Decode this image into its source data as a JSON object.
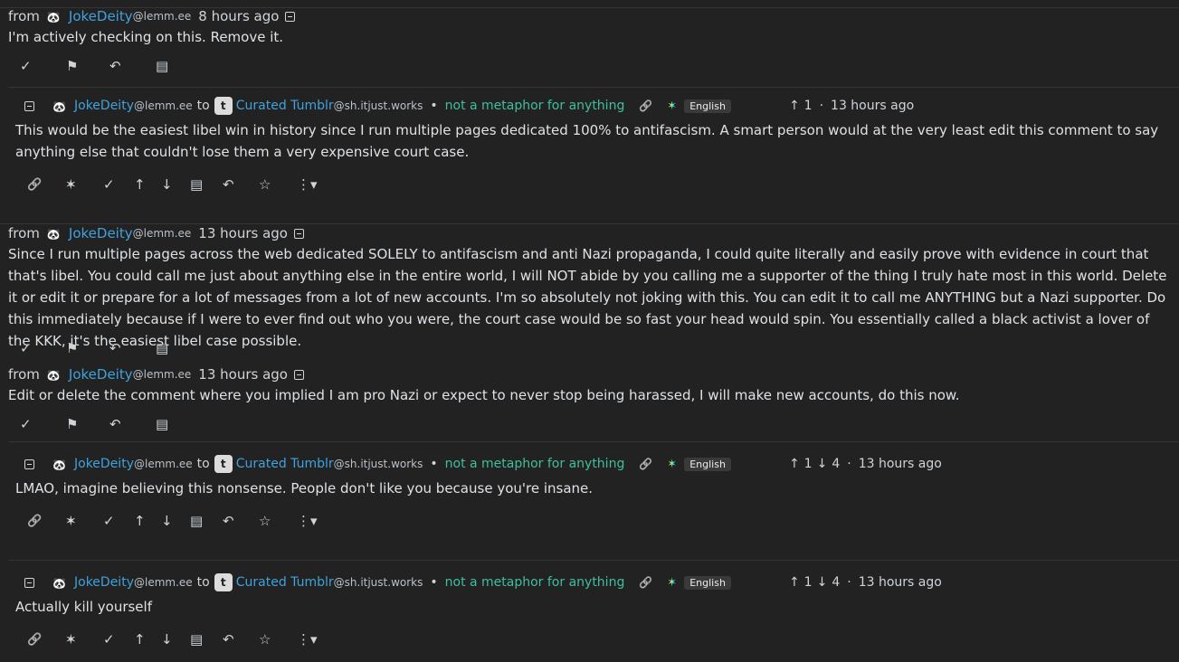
{
  "messages": [
    {
      "from": "from",
      "user": "JokeDeity",
      "instance": "@lemm.ee",
      "time": "8 hours ago",
      "text": "I'm actively checking on this. Remove it."
    },
    {
      "from": "from",
      "user": "JokeDeity",
      "instance": "@lemm.ee",
      "time": "13 hours ago",
      "text": "Since I run multiple pages across the web dedicated SOLELY to antifascism and anti Nazi propaganda, I could quite literally and easily prove with evidence in court that that's libel. You could call me just about anything else in the entire world, I will NOT abide by you calling me a supporter of the thing I truly hate most in this world. Delete it or edit it or prepare for a lot of messages from a lot of new accounts. I'm so absolutely not joking with this. You can edit it to call me ANYTHING but a Nazi supporter. Do this immediately because if I were to ever find out who you were, the court case would be so fast your head would spin. You essentially called a black activist a lover of the KKK, it's the easiest libel case possible."
    },
    {
      "from": "from",
      "user": "JokeDeity",
      "instance": "@lemm.ee",
      "time": "13 hours ago",
      "text": "Edit or delete the comment where you implied I am pro Nazi or expect to never stop being harassed, I will make new accounts, do this now."
    }
  ],
  "comments": [
    {
      "user": "JokeDeity",
      "instance": "@lemm.ee",
      "to": "to",
      "community": "Curated Tumblr",
      "community_instance": "@sh.itjust.works",
      "post_title": "not a metaphor for anything",
      "language": "English",
      "upvotes": "1",
      "downvotes": "",
      "time": "13 hours ago",
      "text": "This would be the easiest libel win in history since I run multiple pages dedicated 100% to antifascism. A smart person would at the very least edit this comment to say anything else that couldn't lose them a very expensive court case."
    },
    {
      "user": "JokeDeity",
      "instance": "@lemm.ee",
      "to": "to",
      "community": "Curated Tumblr",
      "community_instance": "@sh.itjust.works",
      "post_title": "not a metaphor for anything",
      "language": "English",
      "upvotes": "1",
      "downvotes": "4",
      "time": "13 hours ago",
      "text": "LMAO, imagine believing this nonsense. People don't like you because you're insane."
    },
    {
      "user": "JokeDeity",
      "instance": "@lemm.ee",
      "to": "to",
      "community": "Curated Tumblr",
      "community_instance": "@sh.itjust.works",
      "post_title": "not a metaphor for anything",
      "language": "English",
      "upvotes": "1",
      "downvotes": "4",
      "time": "13 hours ago",
      "text": "Actually kill yourself"
    }
  ],
  "icons": {
    "check": "✓",
    "flag": "⚑",
    "reply": "↶",
    "source": "▤",
    "link": "🔗",
    "up": "↑",
    "down": "↓",
    "star": "☆",
    "more": "⋮▾",
    "community_letter": "t",
    "avatar": "🐼"
  },
  "colors": {
    "background": "#222222",
    "username": "#3fa2dc",
    "post_title": "#3fbf9d",
    "text": "#dee2e6"
  }
}
